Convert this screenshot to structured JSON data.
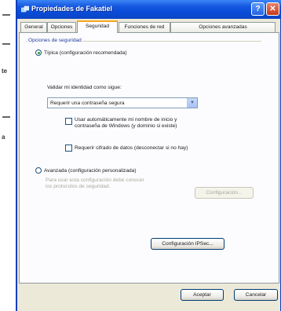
{
  "window": {
    "title": "Propiedades de Fakatiel",
    "help_icon": "help-icon",
    "close_icon": "close-icon"
  },
  "tabs": [
    {
      "label": "General",
      "active": false
    },
    {
      "label": "Opciones",
      "active": false
    },
    {
      "label": "Seguridad",
      "active": true
    },
    {
      "label": "Funciones de red",
      "active": false
    },
    {
      "label": "Opciones avanzadas",
      "active": false
    }
  ],
  "security": {
    "group_label": "Opciones de seguridad",
    "typical_option": {
      "label": "Típica (configuración recomendada)",
      "selected": true
    },
    "validate_label": "Validar mi identidad como sigue:",
    "validate_select": {
      "value": "Requerir una contraseña segura"
    },
    "auto_logon": {
      "label": "Usar automáticamente mi nombre de inicio y contraseña de Windows (y dominio si existe)",
      "checked": false
    },
    "require_encryption": {
      "label": "Requerir cifrado de datos (desconectar si no hay)",
      "checked": false
    },
    "advanced_option": {
      "label": "Avanzada (configuración personalizada)",
      "selected": false
    },
    "advanced_hint": "Para usar esta configuración debe conocer los protocolos de seguridad.",
    "configure_button": "Configuración...",
    "ipsec_button": "Configuración IPSec..."
  },
  "footer": {
    "accept_button": "Aceptar",
    "cancel_button": "Cancelar"
  },
  "colors": {
    "titlebar": "#0a4bd6",
    "accent_tab": "#f5a623",
    "group_title": "#1f3d9a"
  }
}
